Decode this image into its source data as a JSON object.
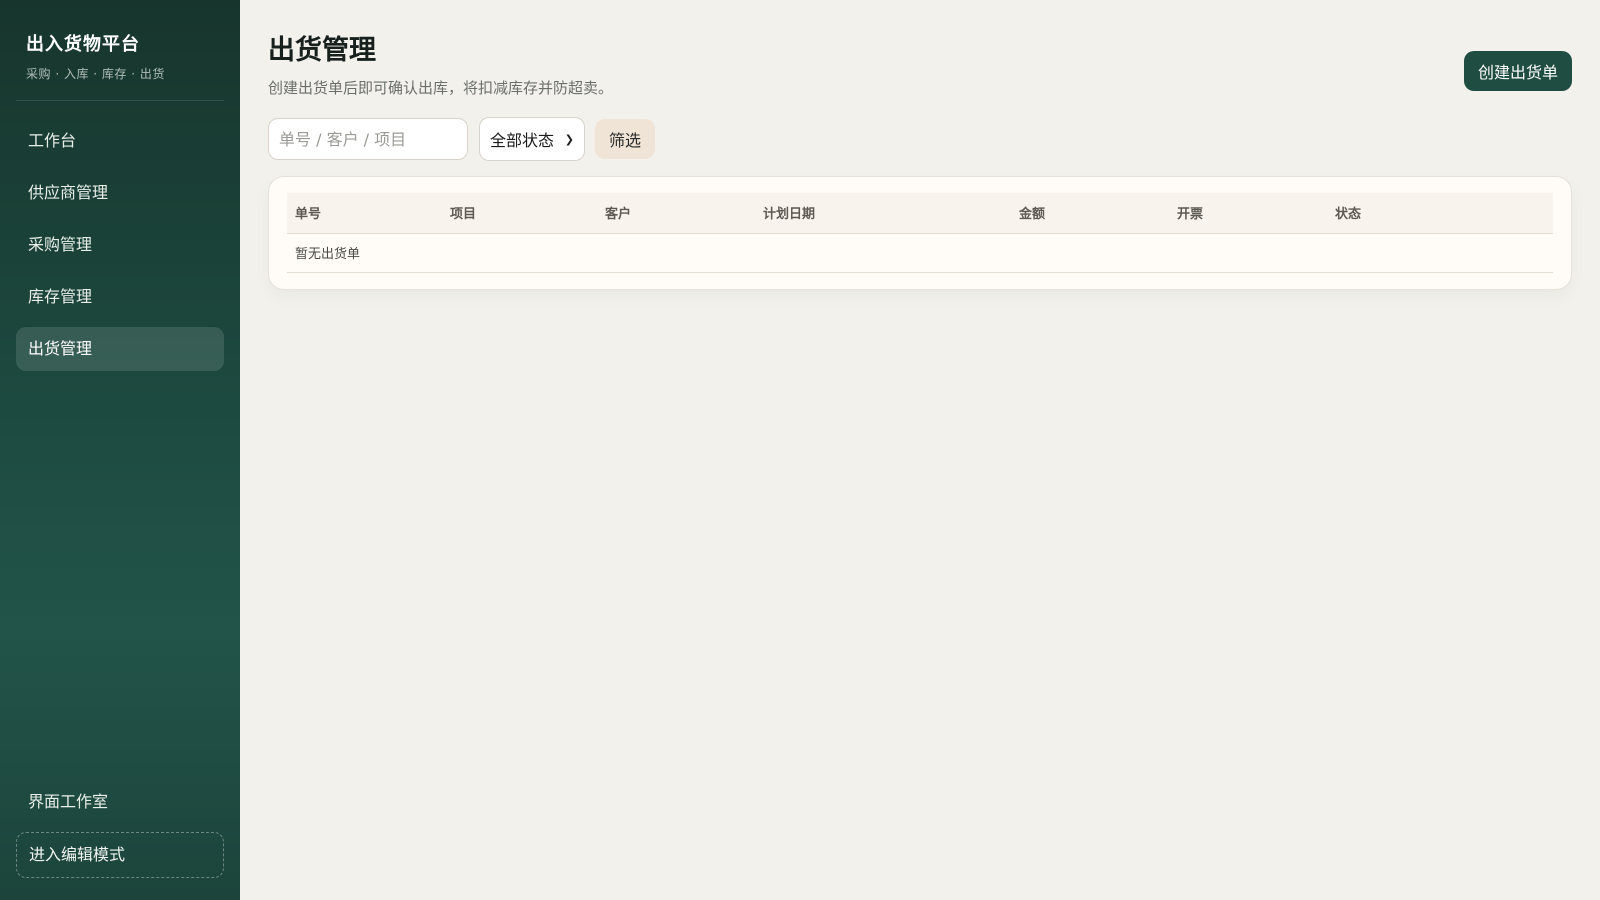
{
  "sidebar": {
    "brand_title": "出入货物平台",
    "brand_subtitle": "采购 · 入库 · 库存 · 出货",
    "items": [
      {
        "label": "工作台"
      },
      {
        "label": "供应商管理"
      },
      {
        "label": "采购管理"
      },
      {
        "label": "库存管理"
      },
      {
        "label": "出货管理",
        "active": true
      }
    ],
    "studio_label": "界面工作室",
    "edit_mode_label": "进入编辑模式"
  },
  "header": {
    "title": "出货管理",
    "description": "创建出货单后即可确认出库，将扣减库存并防超卖。",
    "create_button": "创建出货单"
  },
  "filters": {
    "search_placeholder": "单号 / 客户 / 项目",
    "status_value": "全部状态",
    "filter_button": "筛选"
  },
  "table": {
    "columns": [
      "单号",
      "项目",
      "客户",
      "计划日期",
      "金额",
      "开票",
      "状态"
    ],
    "empty_text": "暂无出货单"
  },
  "colors": {
    "sidebar_bg": "#1d4a40",
    "primary": "#1f4d41",
    "page_bg": "#f3f1ec"
  }
}
